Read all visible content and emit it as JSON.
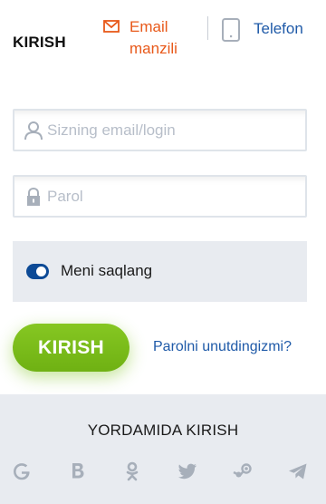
{
  "header": {
    "title": "KIRISH",
    "tab_email_label_line1": "Email",
    "tab_email_label_line2": "manzili",
    "tab_phone_label": "Telefon"
  },
  "form": {
    "login_placeholder": "Sizning email/login",
    "login_value": "",
    "password_placeholder": "Parol",
    "password_value": "",
    "remember_label": "Meni saqlang",
    "remember_checked": true,
    "submit_label": "KIRISH",
    "forgot_label": "Parolni unutdingizmi?"
  },
  "social": {
    "title": "YORDAMIDA KIRISH",
    "icons": [
      "google-icon",
      "vk-icon",
      "odnoklassniki-icon",
      "twitter-icon",
      "steam-icon",
      "telegram-icon"
    ]
  },
  "colors": {
    "accent_orange": "#e8591a",
    "link_blue": "#1f5aa8",
    "toggle_blue": "#0d4a96",
    "submit_green": "#7cc41c",
    "panel_gray": "#e8ebf0",
    "icon_gray": "#a7afba"
  }
}
